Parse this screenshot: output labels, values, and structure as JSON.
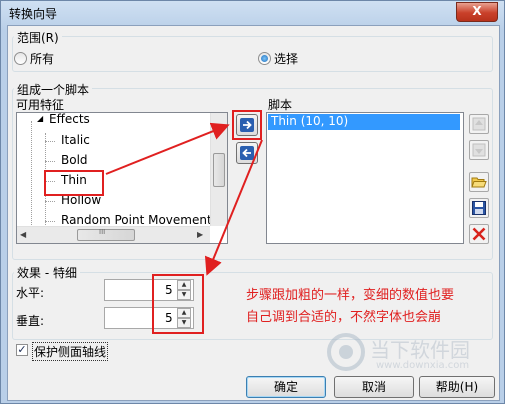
{
  "window": {
    "title": "转换向导",
    "close_label": "X"
  },
  "scope": {
    "label": "范围(R)",
    "options": [
      {
        "label": "所有",
        "selected": false
      },
      {
        "label": "选择",
        "selected": true
      }
    ]
  },
  "compose": {
    "label": "组成一个脚本",
    "available_label": "可用特征",
    "tree_items": [
      "Effects",
      "Italic",
      "Bold",
      "Thin",
      "Hollow",
      "Random Point Movement"
    ],
    "hscroll_thumb_glyph": "III",
    "script_label": "脚本",
    "script_items": [
      "Thin (10, 10)"
    ],
    "add_icon": "arrow-right-icon",
    "remove_icon": "arrow-left-icon"
  },
  "effect": {
    "label": "效果 - 特细",
    "horizontal_label": "水平:",
    "horizontal_value": "5",
    "vertical_label": "垂直:",
    "vertical_value": "5"
  },
  "protect": {
    "label": "保护侧面轴线",
    "checked": true,
    "check_glyph": "✓"
  },
  "buttons": {
    "ok": "确定",
    "cancel": "取消",
    "help": "帮助(H)"
  },
  "annotation": {
    "line1": "步骤跟加粗的一样，变细的数值也要",
    "line2": "自己调到合适的，不然字体也会崩"
  },
  "watermark": {
    "name": "当下软件园",
    "url": "www.downxia.com"
  },
  "colors": {
    "annotation_red": "#e02020",
    "selection_blue": "#3399ff",
    "arrow_blue": "#2a5fb0"
  }
}
